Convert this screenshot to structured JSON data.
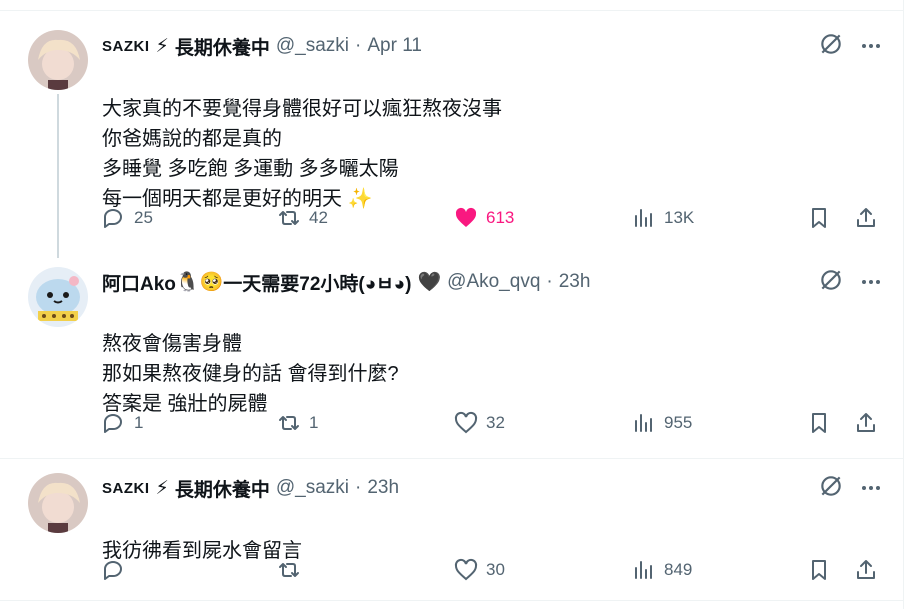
{
  "tweets": [
    {
      "name_prefix": "SAZKI",
      "name_rest": "長期休養中",
      "handle": "@_sazki",
      "sep": "·",
      "time": "Apr 11",
      "text": "大家真的不要覺得身體很好可以瘋狂熬夜沒事\n你爸媽說的都是真的\n多睡覺 多吃飽 多運動 多多曬太陽\n每一個明天都是更好的明天 ✨",
      "replies": "25",
      "retweets": "42",
      "likes": "613",
      "views": "13K",
      "liked": true
    },
    {
      "name_prefix": "阿口Ako",
      "name_rest": "一天需要72小時(◕ㅂ◕)",
      "handle": "@Ako_qvq",
      "sep": "·",
      "time": "23h",
      "text": "熬夜會傷害身體\n那如果熬夜健身的話 會得到什麼?\n答案是 強壯的屍體",
      "replies": "1",
      "retweets": "1",
      "likes": "32",
      "views": "955",
      "liked": false
    },
    {
      "name_prefix": "SAZKI",
      "name_rest": "長期休養中",
      "handle": "@_sazki",
      "sep": "·",
      "time": "23h",
      "text": "我彷彿看到屍水會留言",
      "replies": "",
      "retweets": "",
      "likes": "30",
      "views": "849",
      "liked": false
    }
  ],
  "colors": {
    "muted": "#536471",
    "like": "#f91880",
    "line": "#eff3f4"
  },
  "emoji": {
    "lightning": "⚡",
    "sparkles": "✨",
    "penguin": "🐧",
    "pleading": "🥺",
    "heart_broken": "🖤"
  }
}
